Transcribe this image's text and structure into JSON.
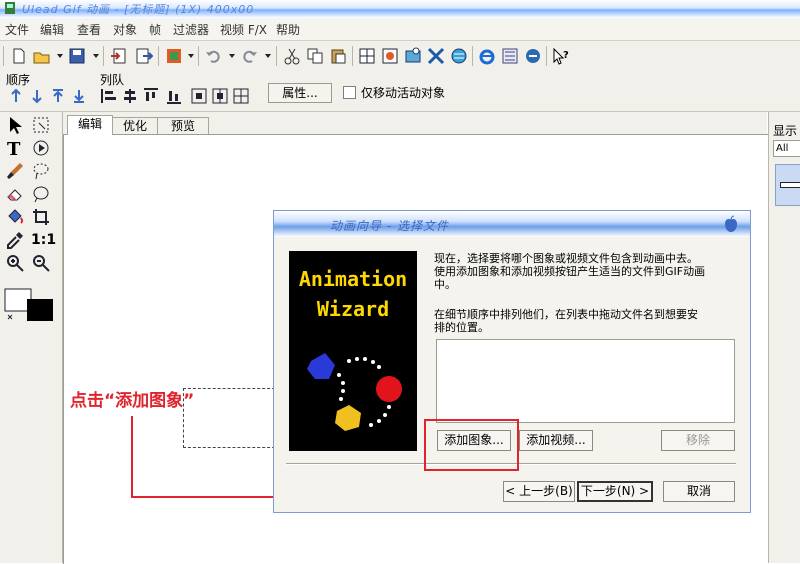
{
  "titlebar": {
    "text": "Ulead Gif 动画 - [无标题] (1X) 400x00"
  },
  "menu": [
    {
      "label": "文件"
    },
    {
      "label": "编辑"
    },
    {
      "label": "查看"
    },
    {
      "label": "对象"
    },
    {
      "label": "帧"
    },
    {
      "label": "过滤器"
    },
    {
      "label": "视频 F/X"
    },
    {
      "label": "帮助"
    }
  ],
  "orderbar": {
    "order_label": "顺序",
    "queue_label": "列队",
    "properties_button": "属性...",
    "only_move_label": "仅移动活动对象",
    "only_move_checked": false
  },
  "palette": {
    "ratio_label": "1:1"
  },
  "tabs": [
    {
      "label": "编辑",
      "active": true
    },
    {
      "label": "优化",
      "active": false
    },
    {
      "label": "预览",
      "active": false
    }
  ],
  "rightpanel": {
    "title": "显示",
    "filter": "All"
  },
  "annotation": {
    "text": "点击“添加图象”",
    "color": "#e0242e"
  },
  "wizard": {
    "title": "动画向导 - 选择文件",
    "image_line1": "Animation",
    "image_line2": "Wizard",
    "desc_line1": "现在，选择要将哪个图象或视频文件包含到动画中去。",
    "desc_line2": "使用添加图象和添加视频按钮产生适当的文件到GIF动画",
    "desc_line3": "中。",
    "order_line1": "在细节顺序中排列他们，在列表中拖动文件名到想要安",
    "order_line2": "排的位置。",
    "add_image": "添加图象...",
    "add_video": "添加视频...",
    "remove": "移除",
    "back": "< 上一步(B)",
    "next": "下一步(N) >",
    "cancel": "取消"
  },
  "colors": {
    "accent": "#e0242e",
    "title_blue": "#3b68c4",
    "logo_yellow": "#ffd800"
  }
}
